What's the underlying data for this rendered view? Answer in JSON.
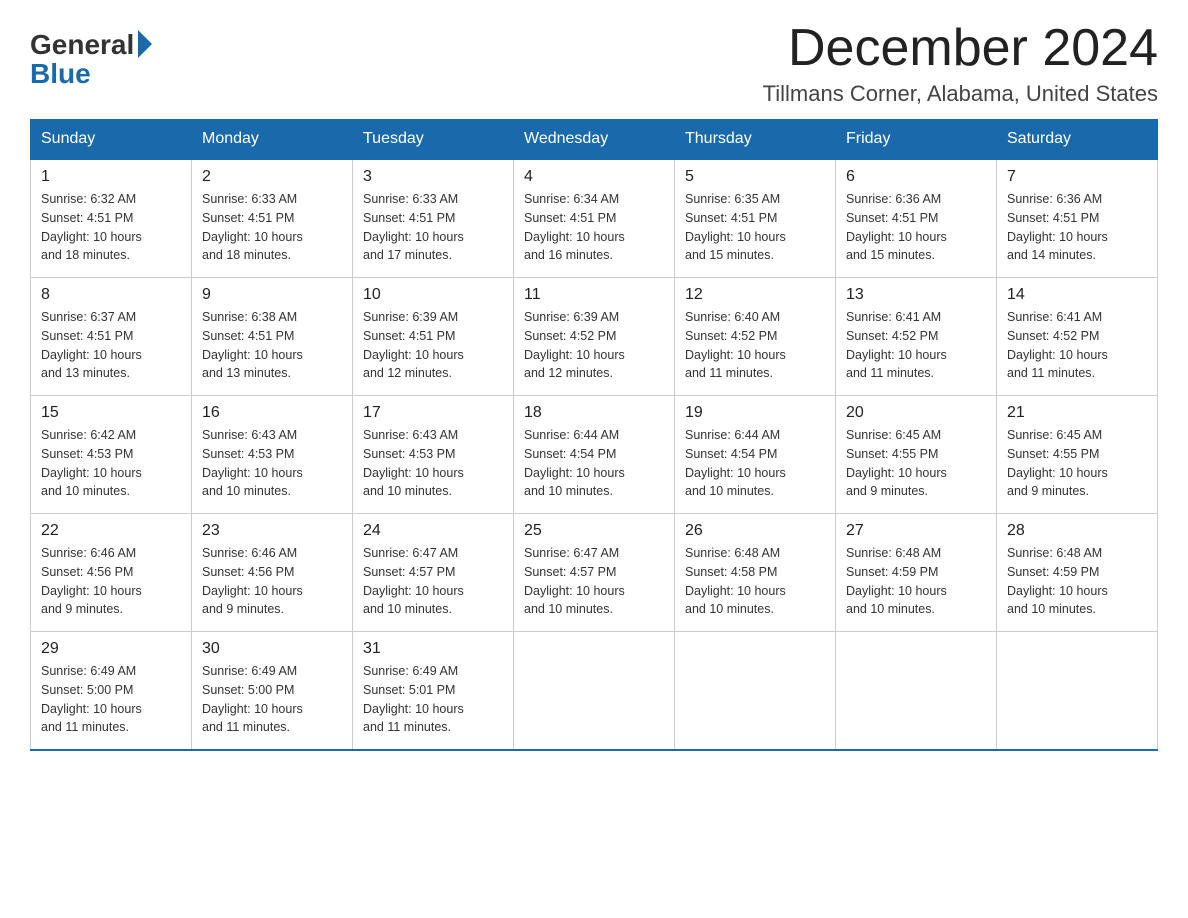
{
  "header": {
    "logo": {
      "general": "General",
      "blue": "Blue"
    },
    "title": "December 2024",
    "location": "Tillmans Corner, Alabama, United States"
  },
  "weekdays": [
    "Sunday",
    "Monday",
    "Tuesday",
    "Wednesday",
    "Thursday",
    "Friday",
    "Saturday"
  ],
  "weeks": [
    [
      {
        "day": "1",
        "sunrise": "6:32 AM",
        "sunset": "4:51 PM",
        "daylight": "10 hours and 18 minutes."
      },
      {
        "day": "2",
        "sunrise": "6:33 AM",
        "sunset": "4:51 PM",
        "daylight": "10 hours and 18 minutes."
      },
      {
        "day": "3",
        "sunrise": "6:33 AM",
        "sunset": "4:51 PM",
        "daylight": "10 hours and 17 minutes."
      },
      {
        "day": "4",
        "sunrise": "6:34 AM",
        "sunset": "4:51 PM",
        "daylight": "10 hours and 16 minutes."
      },
      {
        "day": "5",
        "sunrise": "6:35 AM",
        "sunset": "4:51 PM",
        "daylight": "10 hours and 15 minutes."
      },
      {
        "day": "6",
        "sunrise": "6:36 AM",
        "sunset": "4:51 PM",
        "daylight": "10 hours and 15 minutes."
      },
      {
        "day": "7",
        "sunrise": "6:36 AM",
        "sunset": "4:51 PM",
        "daylight": "10 hours and 14 minutes."
      }
    ],
    [
      {
        "day": "8",
        "sunrise": "6:37 AM",
        "sunset": "4:51 PM",
        "daylight": "10 hours and 13 minutes."
      },
      {
        "day": "9",
        "sunrise": "6:38 AM",
        "sunset": "4:51 PM",
        "daylight": "10 hours and 13 minutes."
      },
      {
        "day": "10",
        "sunrise": "6:39 AM",
        "sunset": "4:51 PM",
        "daylight": "10 hours and 12 minutes."
      },
      {
        "day": "11",
        "sunrise": "6:39 AM",
        "sunset": "4:52 PM",
        "daylight": "10 hours and 12 minutes."
      },
      {
        "day": "12",
        "sunrise": "6:40 AM",
        "sunset": "4:52 PM",
        "daylight": "10 hours and 11 minutes."
      },
      {
        "day": "13",
        "sunrise": "6:41 AM",
        "sunset": "4:52 PM",
        "daylight": "10 hours and 11 minutes."
      },
      {
        "day": "14",
        "sunrise": "6:41 AM",
        "sunset": "4:52 PM",
        "daylight": "10 hours and 11 minutes."
      }
    ],
    [
      {
        "day": "15",
        "sunrise": "6:42 AM",
        "sunset": "4:53 PM",
        "daylight": "10 hours and 10 minutes."
      },
      {
        "day": "16",
        "sunrise": "6:43 AM",
        "sunset": "4:53 PM",
        "daylight": "10 hours and 10 minutes."
      },
      {
        "day": "17",
        "sunrise": "6:43 AM",
        "sunset": "4:53 PM",
        "daylight": "10 hours and 10 minutes."
      },
      {
        "day": "18",
        "sunrise": "6:44 AM",
        "sunset": "4:54 PM",
        "daylight": "10 hours and 10 minutes."
      },
      {
        "day": "19",
        "sunrise": "6:44 AM",
        "sunset": "4:54 PM",
        "daylight": "10 hours and 10 minutes."
      },
      {
        "day": "20",
        "sunrise": "6:45 AM",
        "sunset": "4:55 PM",
        "daylight": "10 hours and 9 minutes."
      },
      {
        "day": "21",
        "sunrise": "6:45 AM",
        "sunset": "4:55 PM",
        "daylight": "10 hours and 9 minutes."
      }
    ],
    [
      {
        "day": "22",
        "sunrise": "6:46 AM",
        "sunset": "4:56 PM",
        "daylight": "10 hours and 9 minutes."
      },
      {
        "day": "23",
        "sunrise": "6:46 AM",
        "sunset": "4:56 PM",
        "daylight": "10 hours and 9 minutes."
      },
      {
        "day": "24",
        "sunrise": "6:47 AM",
        "sunset": "4:57 PM",
        "daylight": "10 hours and 10 minutes."
      },
      {
        "day": "25",
        "sunrise": "6:47 AM",
        "sunset": "4:57 PM",
        "daylight": "10 hours and 10 minutes."
      },
      {
        "day": "26",
        "sunrise": "6:48 AM",
        "sunset": "4:58 PM",
        "daylight": "10 hours and 10 minutes."
      },
      {
        "day": "27",
        "sunrise": "6:48 AM",
        "sunset": "4:59 PM",
        "daylight": "10 hours and 10 minutes."
      },
      {
        "day": "28",
        "sunrise": "6:48 AM",
        "sunset": "4:59 PM",
        "daylight": "10 hours and 10 minutes."
      }
    ],
    [
      {
        "day": "29",
        "sunrise": "6:49 AM",
        "sunset": "5:00 PM",
        "daylight": "10 hours and 11 minutes."
      },
      {
        "day": "30",
        "sunrise": "6:49 AM",
        "sunset": "5:00 PM",
        "daylight": "10 hours and 11 minutes."
      },
      {
        "day": "31",
        "sunrise": "6:49 AM",
        "sunset": "5:01 PM",
        "daylight": "10 hours and 11 minutes."
      },
      null,
      null,
      null,
      null
    ]
  ],
  "labels": {
    "sunrise": "Sunrise:",
    "sunset": "Sunset:",
    "daylight": "Daylight:"
  }
}
